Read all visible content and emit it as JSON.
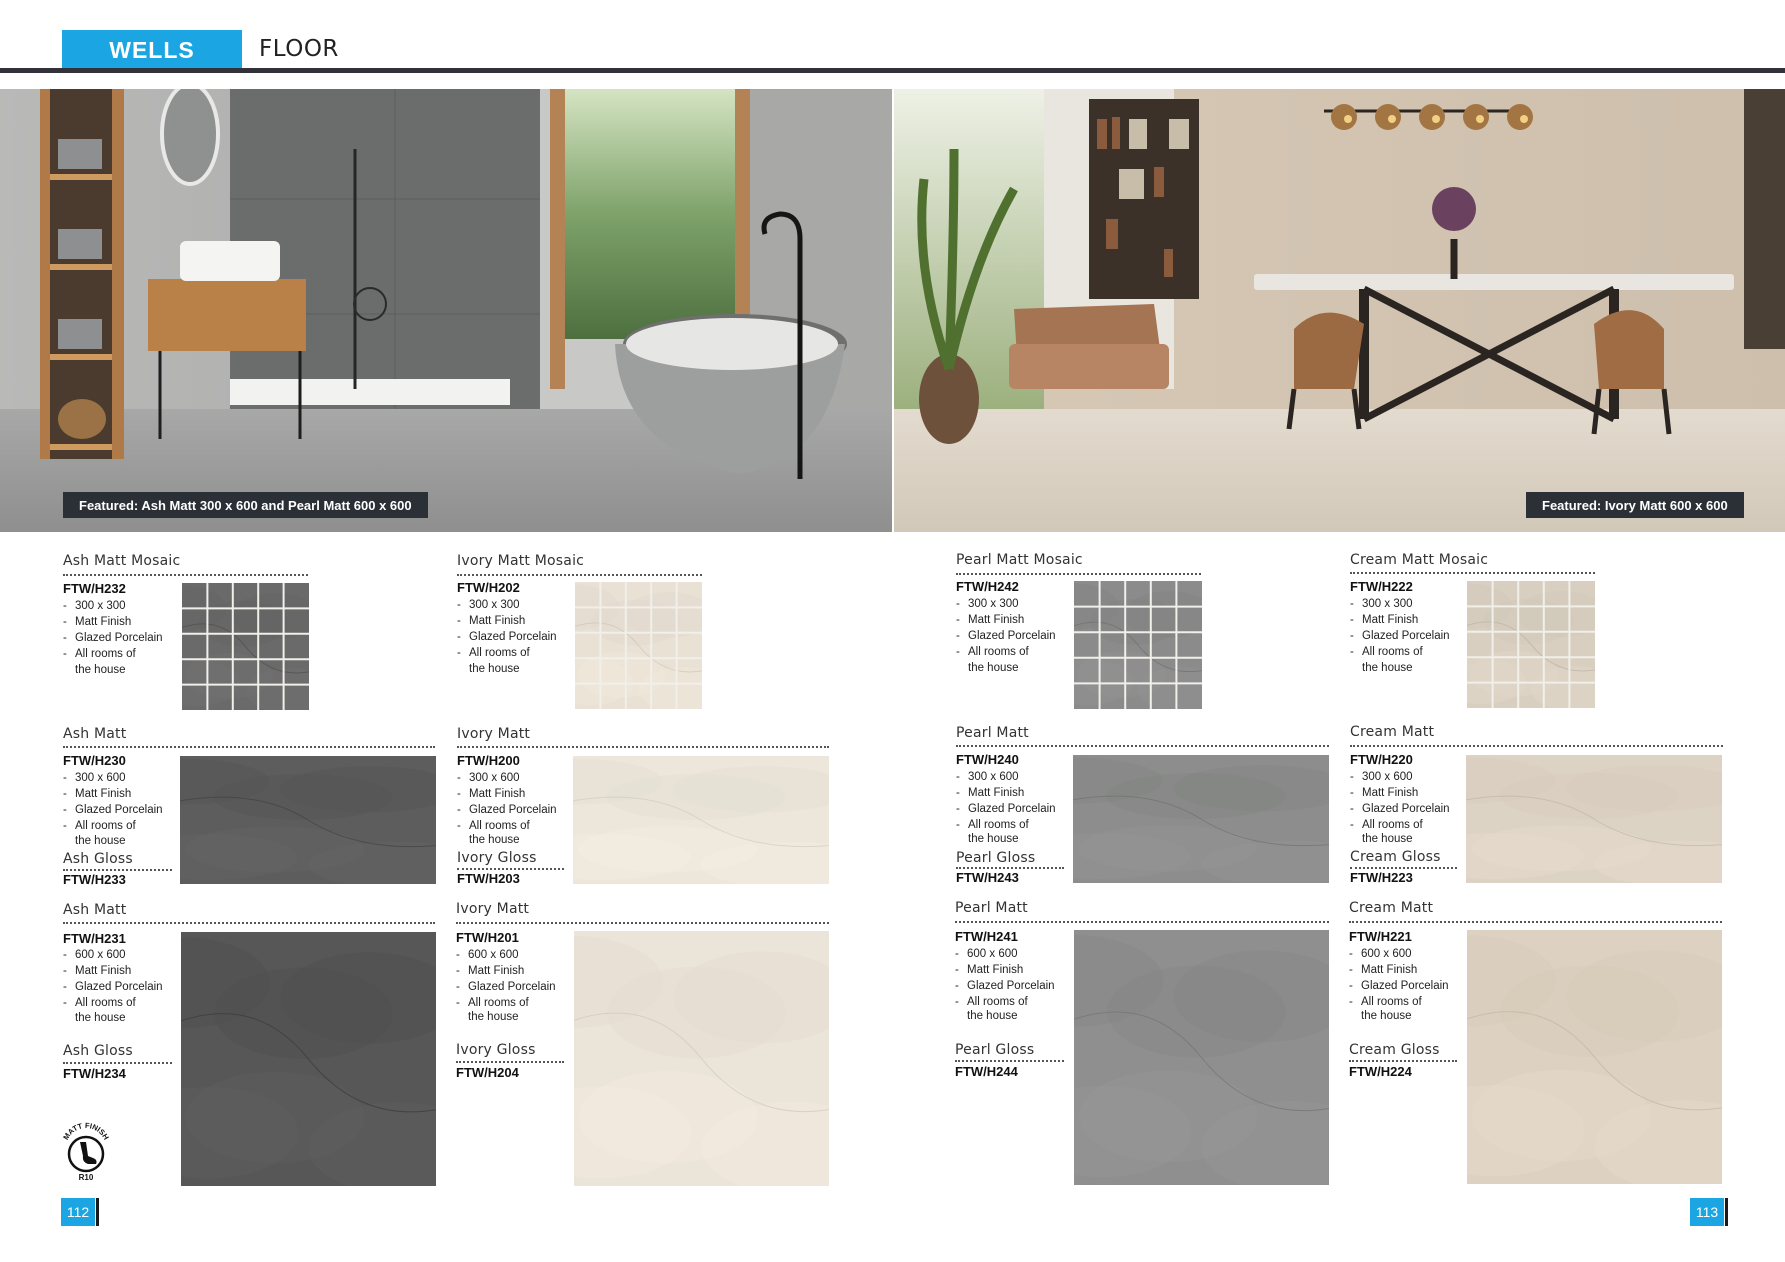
{
  "header": {
    "brand": "WELLS",
    "section": "FLOOR"
  },
  "hero": {
    "left_caption": "Featured: Ash Matt 300 x 600 and Pearl Matt 600 x 600",
    "right_caption": "Featured: Ivory Matt 600 x 600"
  },
  "products": {
    "ash_mosaic": {
      "title": "Ash Matt Mosaic",
      "code": "FTW/H232",
      "specs": [
        "300 x 300",
        "Matt Finish",
        "Glazed Porcelain",
        "All rooms of"
      ],
      "specs_cont": "the house",
      "color": "#6a6a6a"
    },
    "ivory_mosaic": {
      "title": "Ivory Matt Mosaic",
      "code": "FTW/H202",
      "specs": [
        "300 x 300",
        "Matt Finish",
        "Glazed Porcelain",
        "All rooms of"
      ],
      "specs_cont": "the house",
      "color": "#e9e1d4"
    },
    "ash_300": {
      "title": "Ash Matt",
      "code": "FTW/H230",
      "specs": [
        "300 x 600",
        "Matt Finish",
        "Glazed Porcelain",
        "All rooms of"
      ],
      "specs_cont": "the house",
      "gloss_title": "Ash Gloss",
      "gloss_code": "FTW/H233",
      "color": "#5d5d5d"
    },
    "ivory_300": {
      "title": "Ivory Matt",
      "code": "FTW/H200",
      "specs": [
        "300 x 600",
        "Matt Finish",
        "Glazed Porcelain",
        "All rooms of"
      ],
      "specs_cont": "the house",
      "gloss_title": "Ivory Gloss",
      "gloss_code": "FTW/H203",
      "color": "#ede6da"
    },
    "ash_600": {
      "title": "Ash Matt",
      "code": "FTW/H231",
      "specs": [
        "600 x 600",
        "Matt Finish",
        "Glazed Porcelain",
        "All rooms of"
      ],
      "specs_cont": "the house",
      "gloss_title": "Ash Gloss",
      "gloss_code": "FTW/H234",
      "color": "#575757"
    },
    "ivory_600": {
      "title": "Ivory Matt",
      "code": "FTW/H201",
      "specs": [
        "600 x 600",
        "Matt Finish",
        "Glazed Porcelain",
        "All rooms of"
      ],
      "specs_cont": "the house",
      "gloss_title": "Ivory Gloss",
      "gloss_code": "FTW/H204",
      "color": "#ebe4d8"
    },
    "pearl_mosaic": {
      "title": "Pearl Matt Mosaic",
      "code": "FTW/H242",
      "specs": [
        "300 x 300",
        "Matt Finish",
        "Glazed Porcelain",
        "All rooms of"
      ],
      "specs_cont": "the house",
      "color": "#8a8b8a"
    },
    "cream_mosaic": {
      "title": "Cream Matt Mosaic",
      "code": "FTW/H222",
      "specs": [
        "300 x 300",
        "Matt Finish",
        "Glazed Porcelain",
        "All rooms of"
      ],
      "specs_cont": "the house",
      "color": "#d9cfc0"
    },
    "pearl_300": {
      "title": "Pearl Matt",
      "code": "FTW/H240",
      "specs": [
        "300 x 600",
        "Matt Finish",
        "Glazed Porcelain",
        "All rooms of"
      ],
      "specs_cont": "the house",
      "gloss_title": "Pearl Gloss",
      "gloss_code": "FTW/H243",
      "color": "#8c8d8c"
    },
    "cream_300": {
      "title": "Cream Matt",
      "code": "FTW/H220",
      "specs": [
        "300 x 600",
        "Matt Finish",
        "Glazed Porcelain",
        "All rooms of"
      ],
      "specs_cont": "the house",
      "gloss_title": "Cream Gloss",
      "gloss_code": "FTW/H223",
      "color": "#ddd3c4"
    },
    "pearl_600": {
      "title": "Pearl Matt",
      "code": "FTW/H241",
      "specs": [
        "600 x 600",
        "Matt Finish",
        "Glazed Porcelain",
        "All rooms of"
      ],
      "specs_cont": "the house",
      "gloss_title": "Pearl Gloss",
      "gloss_code": "FTW/H244",
      "color": "#8e8f8e"
    },
    "cream_600": {
      "title": "Cream Matt",
      "code": "FTW/H221",
      "specs": [
        "600 x 600",
        "Matt Finish",
        "Glazed Porcelain",
        "All rooms of"
      ],
      "specs_cont": "the house",
      "gloss_title": "Cream Gloss",
      "gloss_code": "FTW/H224",
      "color": "#ddd2c2"
    }
  },
  "badge": {
    "arc_text": "MATT FINISH",
    "rating": "R10"
  },
  "pages": {
    "left": "112",
    "right": "113"
  }
}
